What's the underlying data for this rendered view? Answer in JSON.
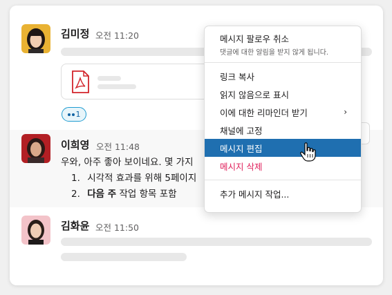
{
  "messages": [
    {
      "author": "김미정",
      "time": "오전 11:20",
      "reaction_count": "1"
    },
    {
      "author": "이희영",
      "time": "오전 11:48",
      "text": "우와, 아주 좋아 보이네요. 몇 가지",
      "list": [
        {
          "num": "1.",
          "text": "시각적 효과를 위해 5페이지"
        },
        {
          "num": "2.",
          "bold": "다음 주",
          "text": " 작업 항목 포함"
        }
      ]
    },
    {
      "author": "김화윤",
      "time": "오전 11:50"
    }
  ],
  "menu": {
    "unfollow": {
      "label": "메시지 팔로우 취소",
      "sub": "댓글에 대한 알림을 받지 않게 됩니다."
    },
    "items": [
      {
        "label": "링크 복사"
      },
      {
        "label": "읽지 않음으로 표시"
      },
      {
        "label": "이에 대한 리마인더 받기",
        "chevron": "›"
      },
      {
        "label": "채널에 고정"
      },
      {
        "label": "메시지 편집"
      },
      {
        "label": "메시지 삭제"
      }
    ],
    "more": "추가 메시지 작업..."
  },
  "colors": {
    "highlight": "#1f6fb0",
    "danger": "#e01e5a",
    "accent": "#1264a3"
  }
}
